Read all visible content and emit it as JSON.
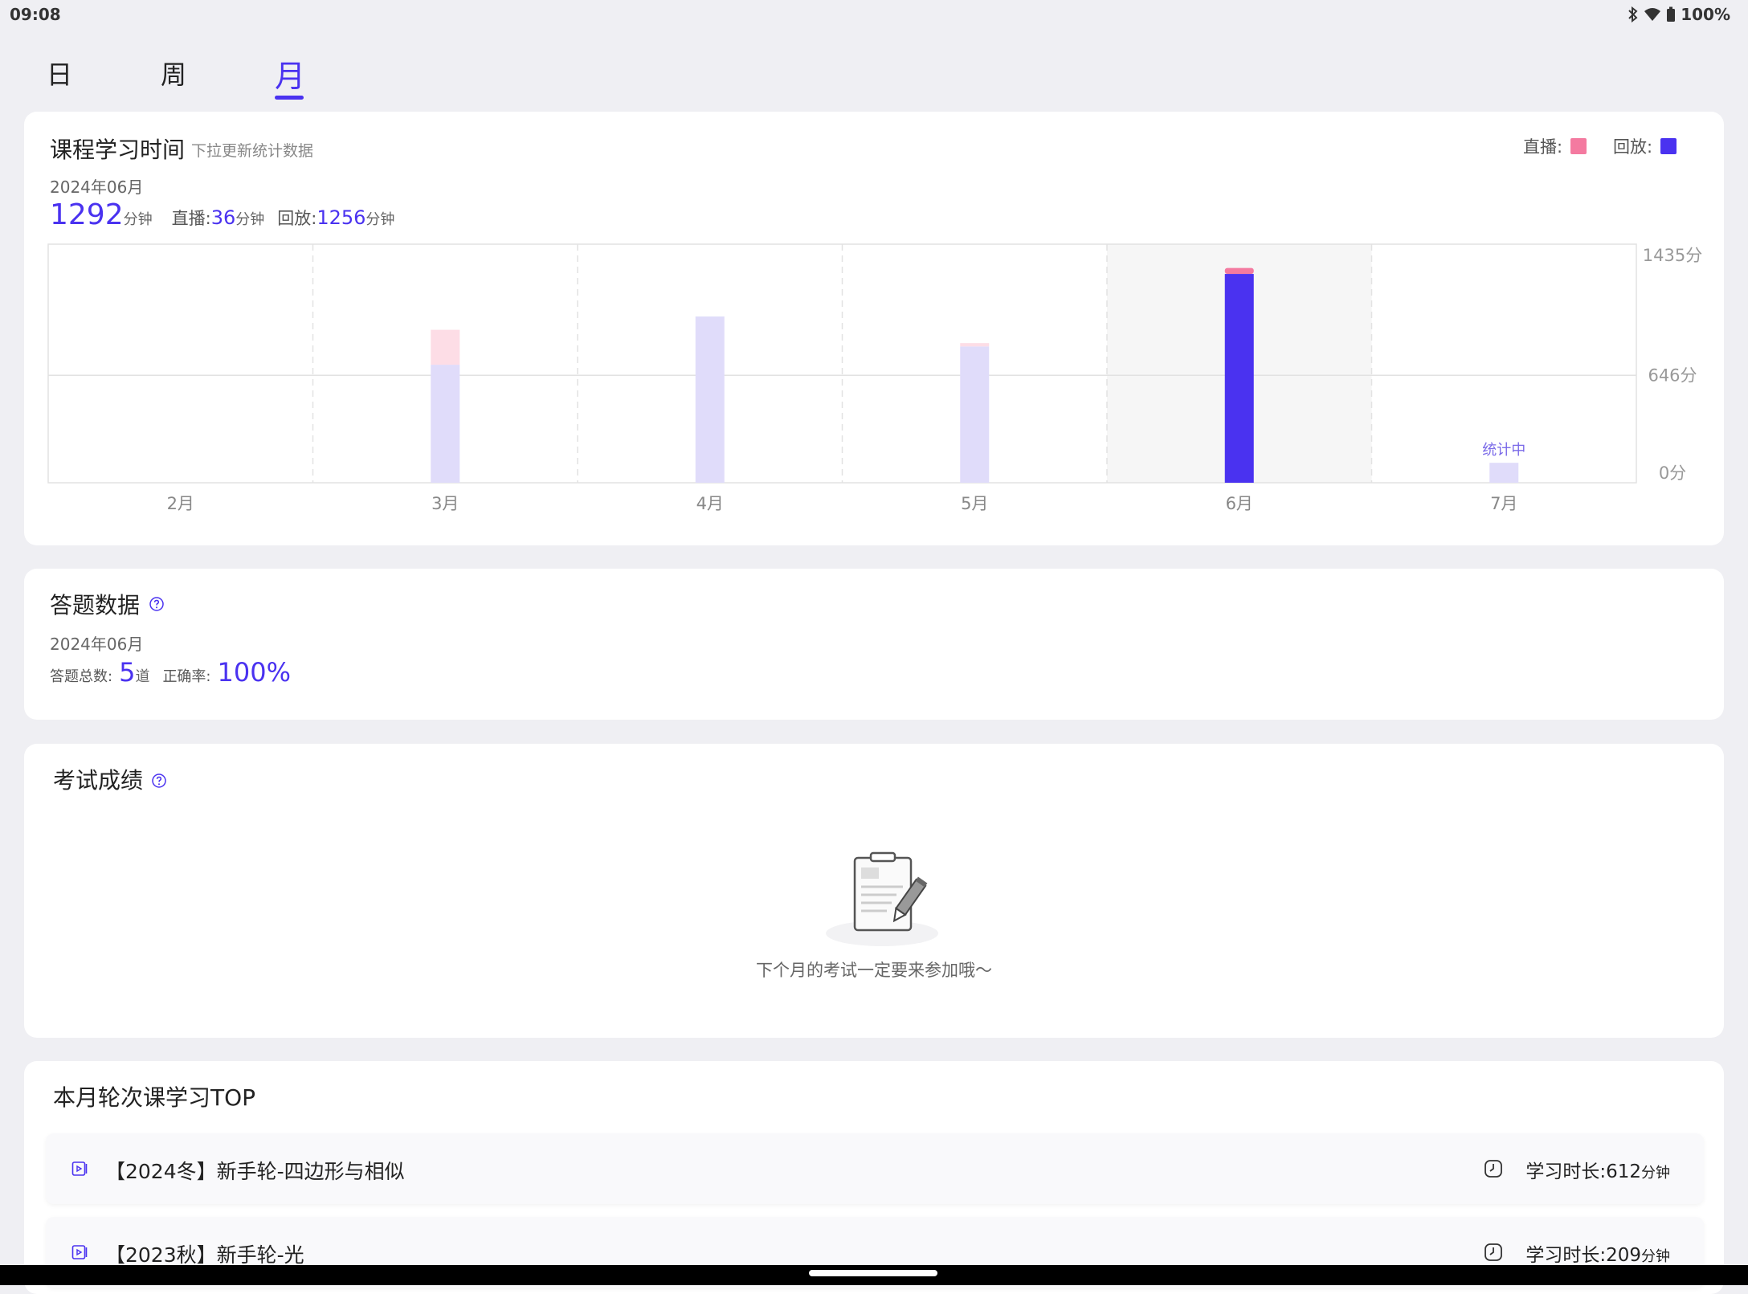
{
  "status": {
    "time": "09:08",
    "battery": "100%"
  },
  "tabs": [
    {
      "label": "日",
      "active": false
    },
    {
      "label": "周",
      "active": false
    },
    {
      "label": "月",
      "active": true
    }
  ],
  "study": {
    "title": "课程学习时间",
    "hint": "下拉更新统计数据",
    "date": "2024年06月",
    "total_value": "1292",
    "total_unit": "分钟",
    "live_label": "直播:",
    "live_value": "36",
    "live_unit": "分钟",
    "replay_label": "回放:",
    "replay_value": "1256",
    "replay_unit": "分钟",
    "legend_live": "直播:",
    "legend_replay": "回放:",
    "colors": {
      "live": "#f47aa0",
      "replay": "#4a32f0",
      "live_faded": "#fddde6",
      "replay_faded": "#e0dcfa"
    }
  },
  "chart_data": {
    "type": "bar",
    "stacked": true,
    "categories": [
      "2月",
      "3月",
      "4月",
      "5月",
      "6月",
      "7月"
    ],
    "series": [
      {
        "name": "回放",
        "values": [
          0,
          710,
          1000,
          820,
          1256,
          120
        ]
      },
      {
        "name": "直播",
        "values": [
          0,
          210,
          0,
          20,
          36,
          0
        ]
      }
    ],
    "highlight_category": "6月",
    "pending_label": "统计中",
    "pending_category": "7月",
    "y_ticks": [
      "1435分",
      "646分",
      "0分"
    ],
    "y_tick_values": [
      1435,
      646,
      0
    ],
    "ylim": [
      0,
      1435
    ],
    "grid": true
  },
  "answers": {
    "title": "答题数据",
    "date": "2024年06月",
    "total_label": "答题总数:",
    "total_value": "5",
    "total_unit": "道",
    "accuracy_label": "正确率:",
    "accuracy_value": "100%"
  },
  "exam": {
    "title": "考试成绩",
    "empty_text": "下个月的考试一定要来参加哦～"
  },
  "top": {
    "title": "本月轮次课学习TOP",
    "items": [
      {
        "name": "【2024冬】新手轮-四边形与相似",
        "duration_label": "学习时长:",
        "duration_value": "612",
        "duration_unit": "分钟"
      },
      {
        "name": "【2023秋】新手轮-光",
        "duration_label": "学习时长:",
        "duration_value": "209",
        "duration_unit": "分钟"
      }
    ]
  }
}
